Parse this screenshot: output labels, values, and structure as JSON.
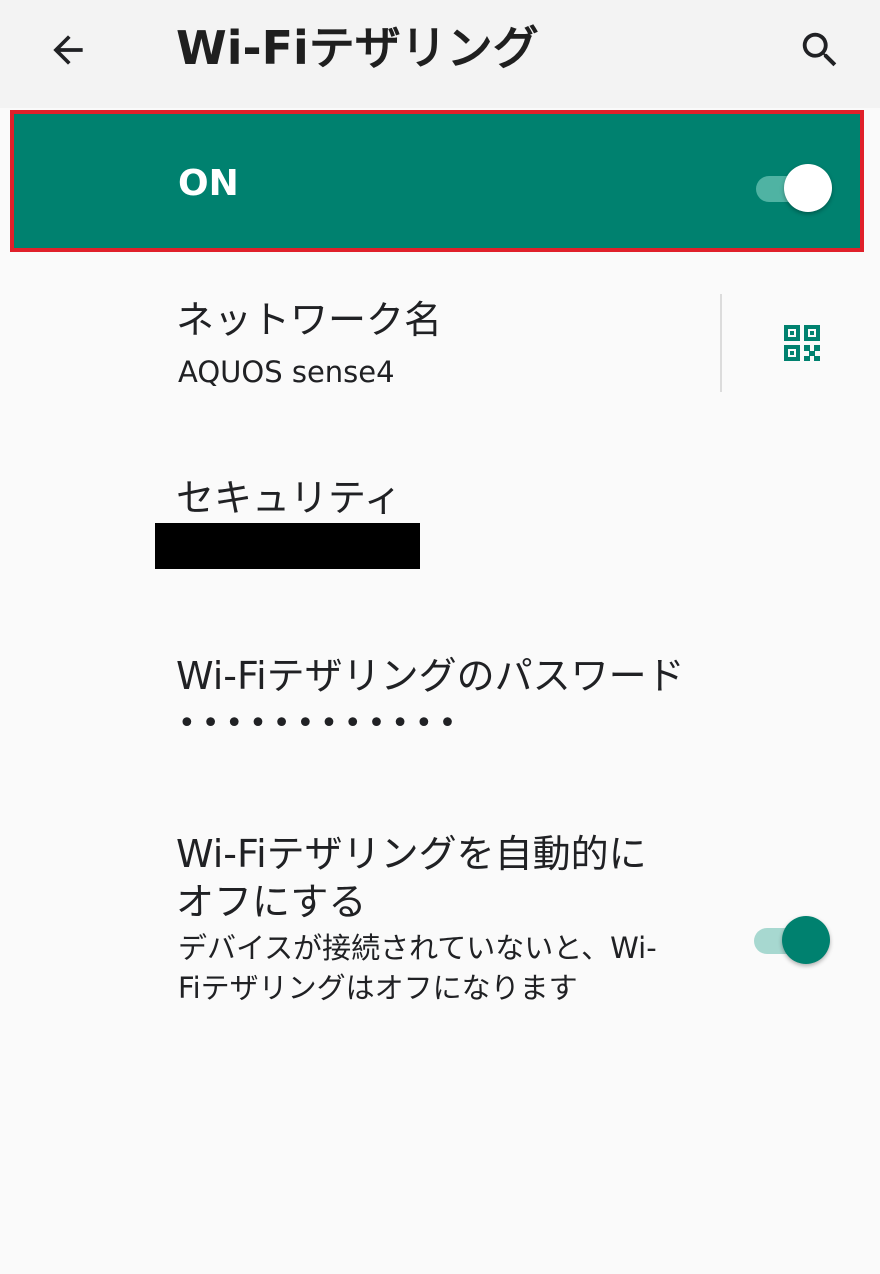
{
  "app_bar": {
    "title": "Wi-Fiテザリング",
    "back_icon": "arrow-back-icon",
    "search_icon": "search-icon"
  },
  "master_switch": {
    "label": "ON",
    "checked": true,
    "background_color": "#00816f",
    "highlight_border_color": "#e0202a"
  },
  "preferences": {
    "network_name": {
      "title": "ネットワーク名",
      "summary": "AQUOS sense4",
      "action_icon": "qr-code-icon"
    },
    "security": {
      "title": "セキュリティ",
      "summary_redacted": true
    },
    "password": {
      "title": "Wi-Fiテザリングのパスワード",
      "summary": "••••••••••••"
    },
    "auto_off": {
      "title": "Wi-Fiテザリングを自動的にオフにする",
      "summary": "デバイスが接続されていないと、Wi-Fiテザリングはオフになります",
      "checked": true
    }
  },
  "colors": {
    "accent": "#00816f",
    "background": "#fafafa",
    "app_bar": "#f3f3f3"
  }
}
